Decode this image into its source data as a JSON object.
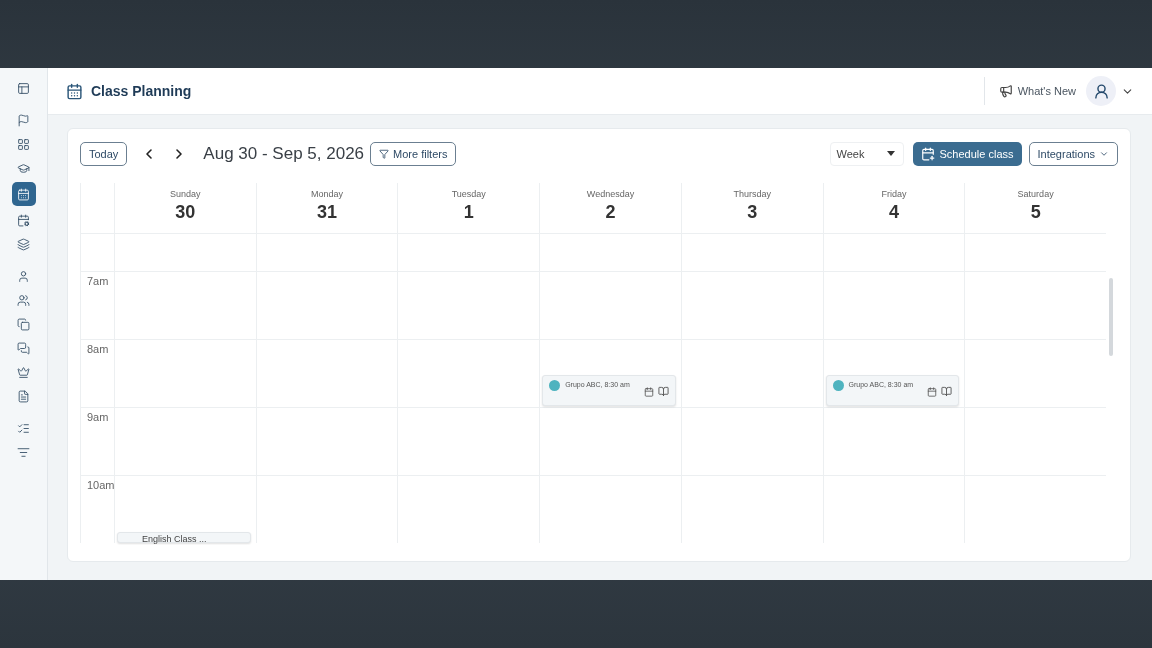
{
  "header": {
    "title": "Class Planning",
    "whats_new": "What's New"
  },
  "sidebar": {
    "groups": [
      {
        "items": [
          {
            "selected": false
          }
        ]
      },
      {
        "items": [
          {
            "selected": false
          },
          {
            "selected": false
          },
          {
            "selected": false
          },
          {
            "selected": true
          },
          {
            "selected": false
          },
          {
            "selected": false
          }
        ]
      },
      {
        "items": [
          {
            "selected": false
          },
          {
            "selected": false
          },
          {
            "selected": false
          },
          {
            "selected": false
          },
          {
            "selected": false
          },
          {
            "selected": false
          }
        ]
      },
      {
        "items": [
          {
            "selected": false
          },
          {
            "selected": false
          }
        ]
      }
    ]
  },
  "toolbar": {
    "today": "Today",
    "date_range": "Aug 30 - Sep 5, 2026",
    "filters": "More filters",
    "view": "Week",
    "schedule": "Schedule class",
    "integrations": "Integrations"
  },
  "calendar": {
    "days": [
      {
        "weekday": "Sunday",
        "date": "30"
      },
      {
        "weekday": "Monday",
        "date": "31"
      },
      {
        "weekday": "Tuesday",
        "date": "1"
      },
      {
        "weekday": "Wednesday",
        "date": "2"
      },
      {
        "weekday": "Thursday",
        "date": "3"
      },
      {
        "weekday": "Friday",
        "date": "4"
      },
      {
        "weekday": "Saturday",
        "date": "5"
      }
    ],
    "rows": [
      {
        "cells": [
          {},
          {},
          {},
          {},
          {},
          {},
          {}
        ]
      },
      {
        "time": "7am",
        "cells": [
          {},
          {},
          {},
          {},
          {},
          {},
          {}
        ]
      },
      {
        "time": "8am",
        "cells": [
          {},
          {},
          {},
          {
            "events": [
              {
                "kind": "group",
                "title": "Grupo ABC, 8:30 am"
              }
            ]
          },
          {},
          {
            "events": [
              {
                "kind": "group",
                "title": "Grupo ABC, 8:30 am"
              }
            ]
          },
          {}
        ]
      },
      {
        "time": "9am",
        "cells": [
          {},
          {},
          {},
          {},
          {},
          {},
          {}
        ]
      },
      {
        "time": "10am",
        "cells": [
          {
            "events": [
              {
                "kind": "class",
                "title": "English Class ..."
              }
            ]
          },
          {},
          {},
          {},
          {},
          {},
          {}
        ]
      }
    ]
  }
}
